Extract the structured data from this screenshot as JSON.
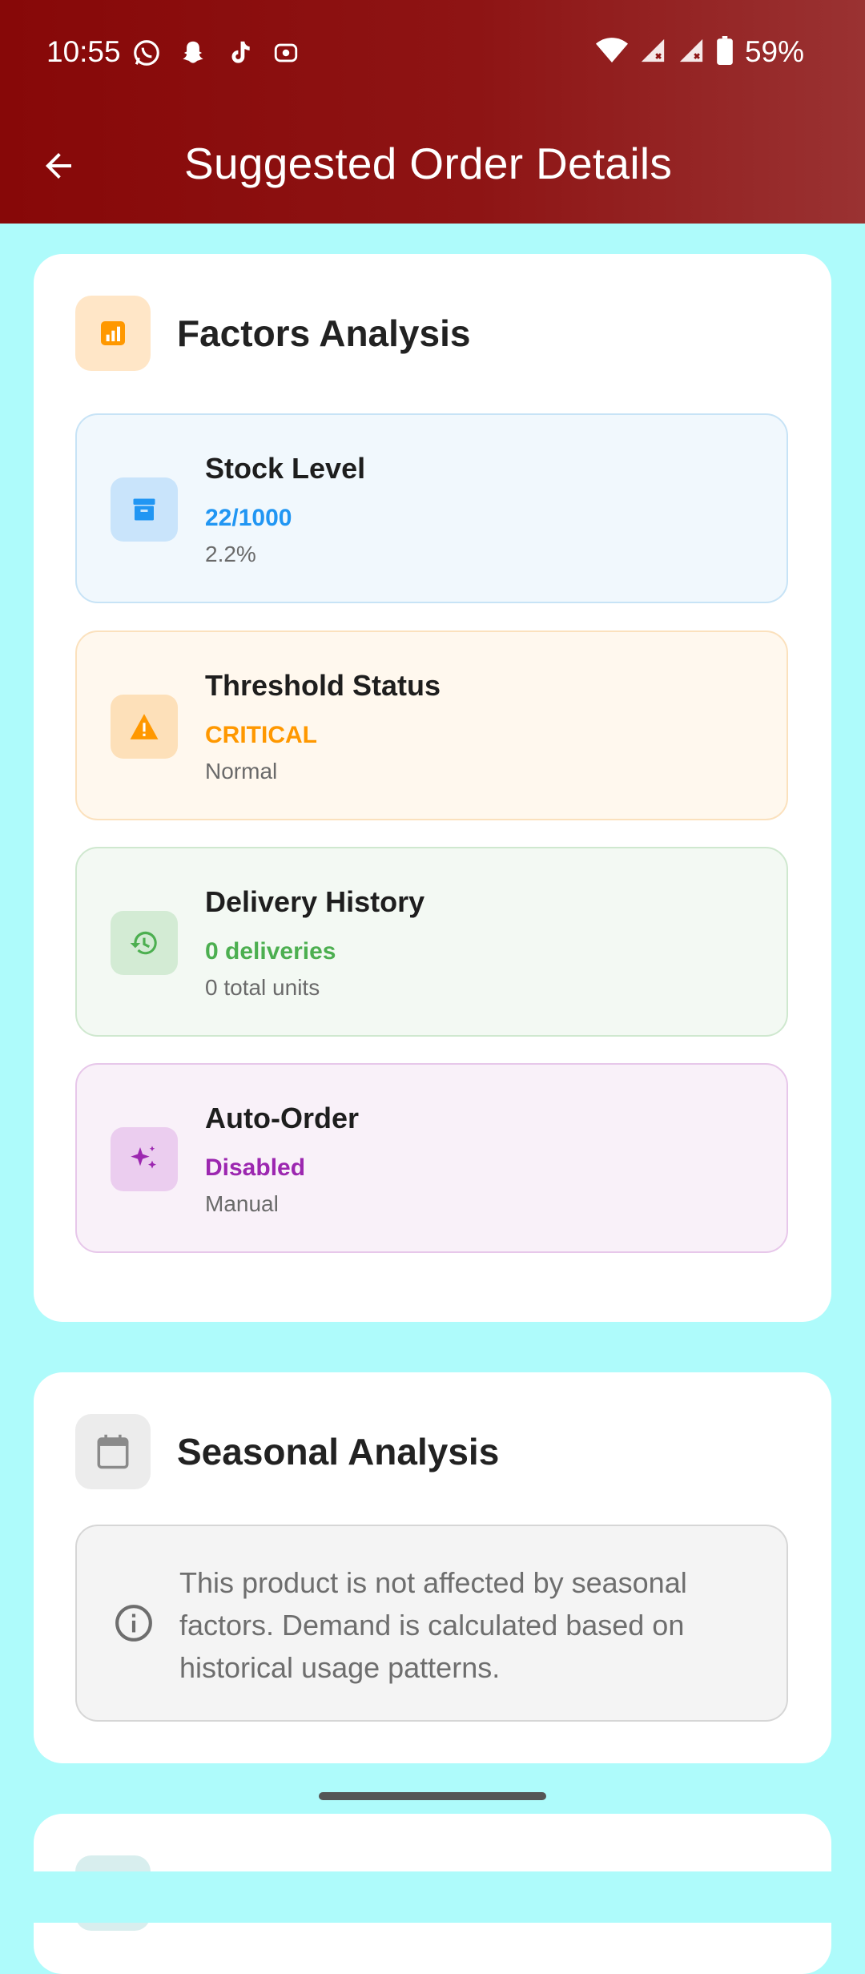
{
  "status_bar": {
    "time": "10:55",
    "battery": "59%",
    "notification_icons": [
      "whatsapp-icon",
      "snapchat-icon",
      "tiktok-icon",
      "screen-record-icon"
    ],
    "system_icons": [
      "wifi-icon",
      "signal-icon",
      "signal-icon",
      "battery-icon"
    ]
  },
  "toolbar": {
    "title": "Suggested Order Details",
    "back_icon": "arrow-back-icon"
  },
  "factors_card": {
    "title": "Factors Analysis",
    "icon": "bar-chart-icon",
    "items": [
      {
        "title": "Stock Level",
        "value": "22/1000",
        "sub": "2.2%",
        "icon": "archive-box-icon",
        "color": "#2196f3"
      },
      {
        "title": "Threshold Status",
        "value": "CRITICAL",
        "sub": "Normal",
        "icon": "warning-icon",
        "color": "#ff9800"
      },
      {
        "title": "Delivery History",
        "value": "0 deliveries",
        "sub": "0 total units",
        "icon": "history-icon",
        "color": "#4caf50"
      },
      {
        "title": "Auto-Order",
        "value": "Disabled",
        "sub": "Manual",
        "icon": "sparkles-icon",
        "color": "#9c27b0"
      }
    ]
  },
  "seasonal_card": {
    "title": "Seasonal Analysis",
    "icon": "calendar-icon",
    "info_icon": "info-icon",
    "message": "This product is not affected by seasonal factors. Demand is calculated based on historical usage patterns."
  }
}
